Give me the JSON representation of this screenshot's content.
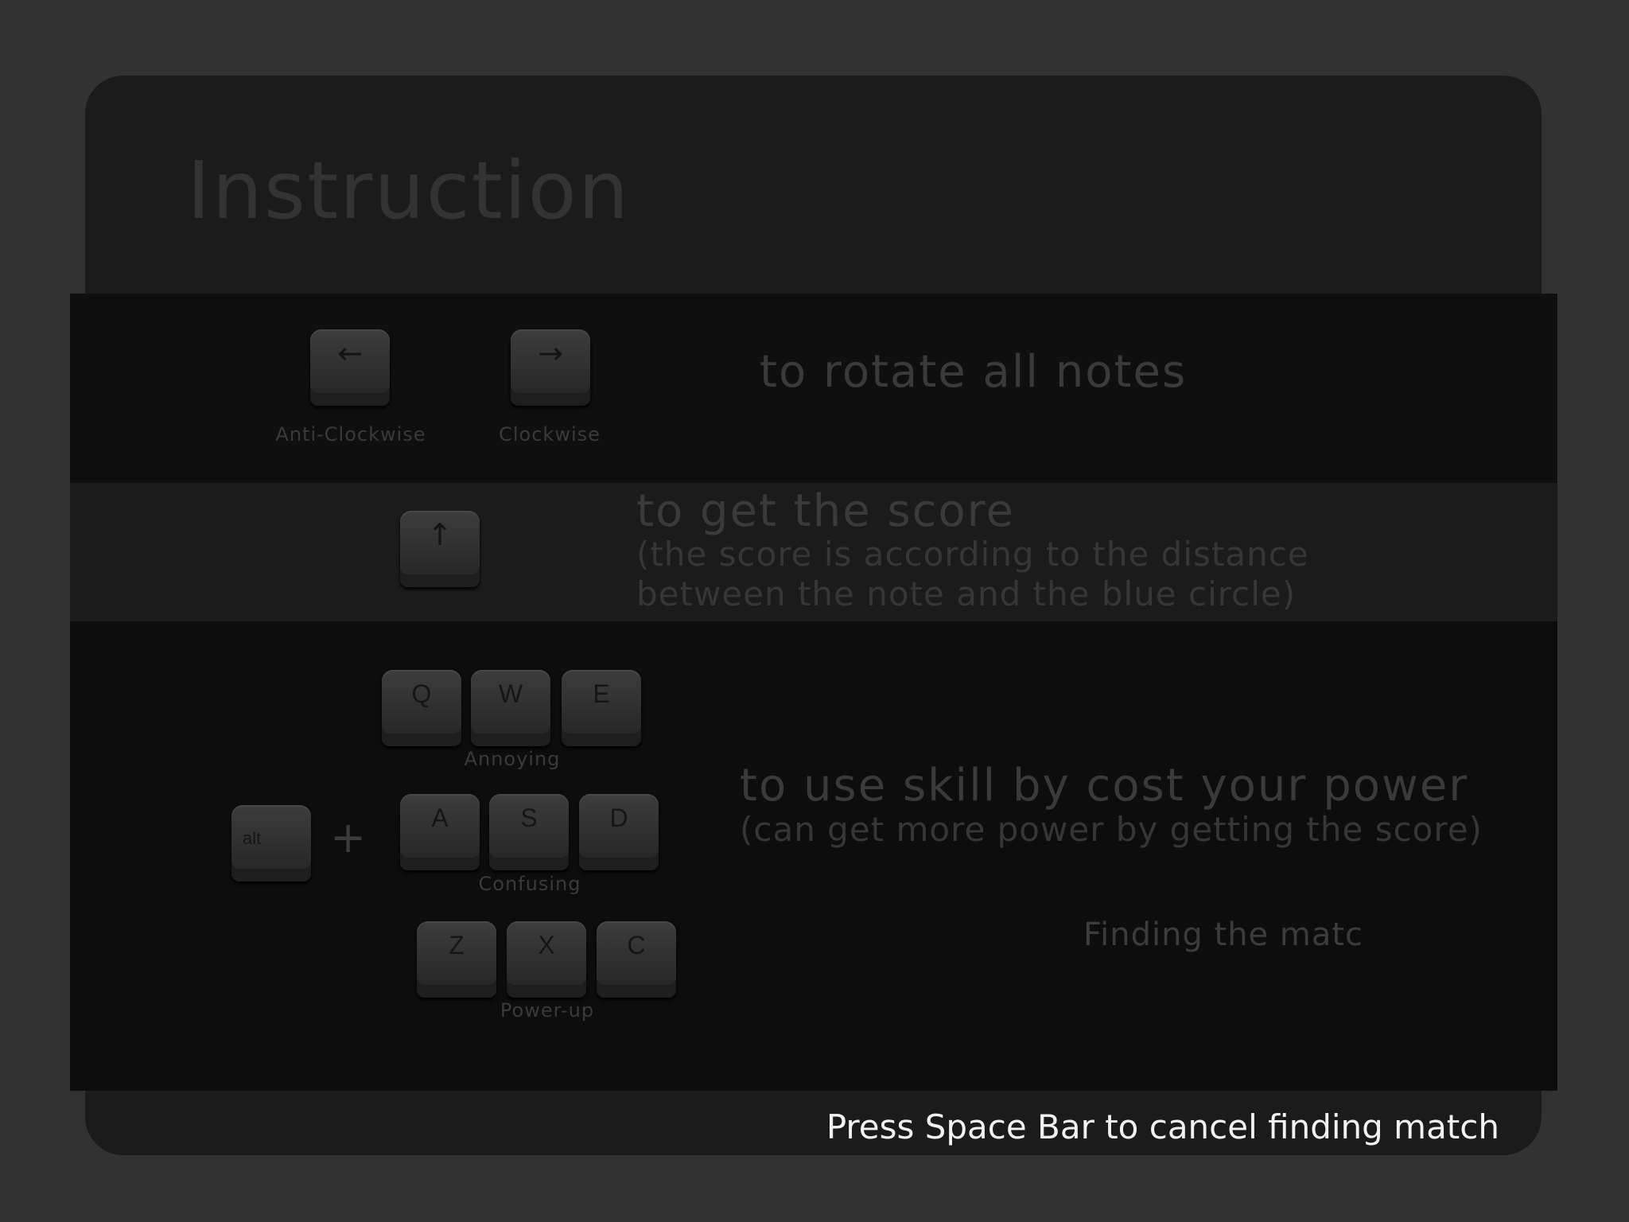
{
  "title": "Instruction",
  "rotate": {
    "left_key": {
      "icon": "arrow-left-icon",
      "glyph": "←",
      "label": "Anti-Clockwise"
    },
    "right_key": {
      "icon": "arrow-right-icon",
      "glyph": "→",
      "label": "Clockwise"
    },
    "description": "to rotate all notes"
  },
  "score": {
    "key": {
      "icon": "arrow-up-icon",
      "glyph": "↑"
    },
    "description": "to get the score",
    "detail": "(the score is according to the distance between the note and the blue circle)"
  },
  "skills": {
    "modifier": "alt",
    "plus": "+",
    "rows": [
      {
        "keys": [
          "Q",
          "W",
          "E"
        ],
        "label": "Annoying"
      },
      {
        "keys": [
          "A",
          "S",
          "D"
        ],
        "label": "Confusing"
      },
      {
        "keys": [
          "Z",
          "X",
          "C"
        ],
        "label": "Power-up"
      }
    ],
    "description": "to use skill by cost your power",
    "detail": "(can get more power by getting the score)"
  },
  "status": "Finding the matc",
  "cancel_hint": "Press Space Bar to cancel finding match"
}
